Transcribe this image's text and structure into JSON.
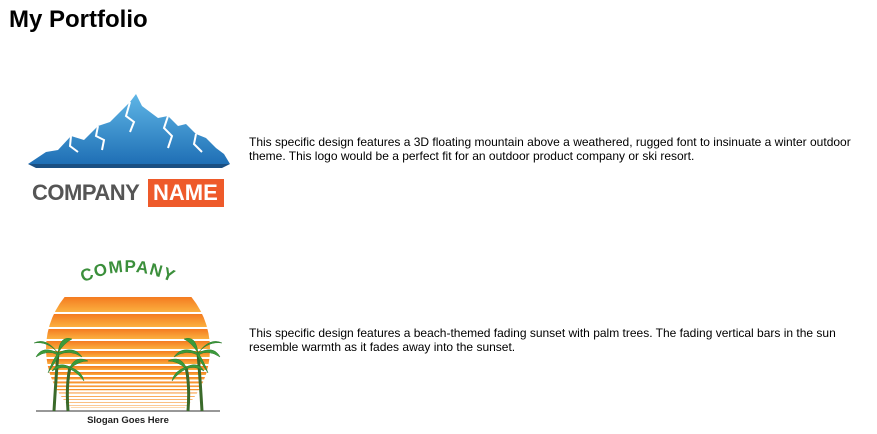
{
  "page": {
    "title": "My Portfolio"
  },
  "portfolio": {
    "items": [
      {
        "logo_word1": "COMPANY",
        "logo_word2": "NAME",
        "description": "This specific design features a 3D floating mountain above a weathered, rugged font to insinuate a winter outdoor theme. This logo would be a perfect fit for an outdoor product company or ski resort."
      },
      {
        "logo_word1": "COMPANY",
        "logo_slogan": "Slogan Goes Here",
        "description": "This specific design features a beach-themed fading sunset with palm trees. The fading vertical bars in the sun resemble warmth as it fades away into the sunset."
      }
    ]
  },
  "colors": {
    "mountain_dark": "#1f6fb5",
    "mountain_light": "#5fb6e6",
    "company_text_gray": "#555555",
    "name_badge_orange": "#ee5a2a",
    "sun_top": "#f47b20",
    "sun_bottom": "#fbb040",
    "palm_green": "#3a9a3a",
    "company_green": "#3b8f3b"
  }
}
